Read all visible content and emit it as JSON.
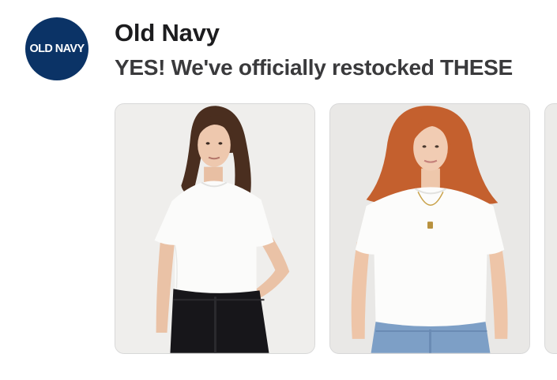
{
  "message": {
    "avatar": {
      "text": "OLD NAVY",
      "background": "#0b3366",
      "text_color": "#ffffff"
    },
    "sender": "Old Navy",
    "subject": "YES! We've officially restocked THESE"
  },
  "carousel": {
    "items": [
      {
        "kind": "product-photo",
        "description_icon": "model-white-tee-black-jeans"
      },
      {
        "kind": "product-photo",
        "description_icon": "model-white-tee-blue-jeans"
      },
      {
        "kind": "product-photo",
        "description_icon": "partially-visible"
      }
    ]
  }
}
